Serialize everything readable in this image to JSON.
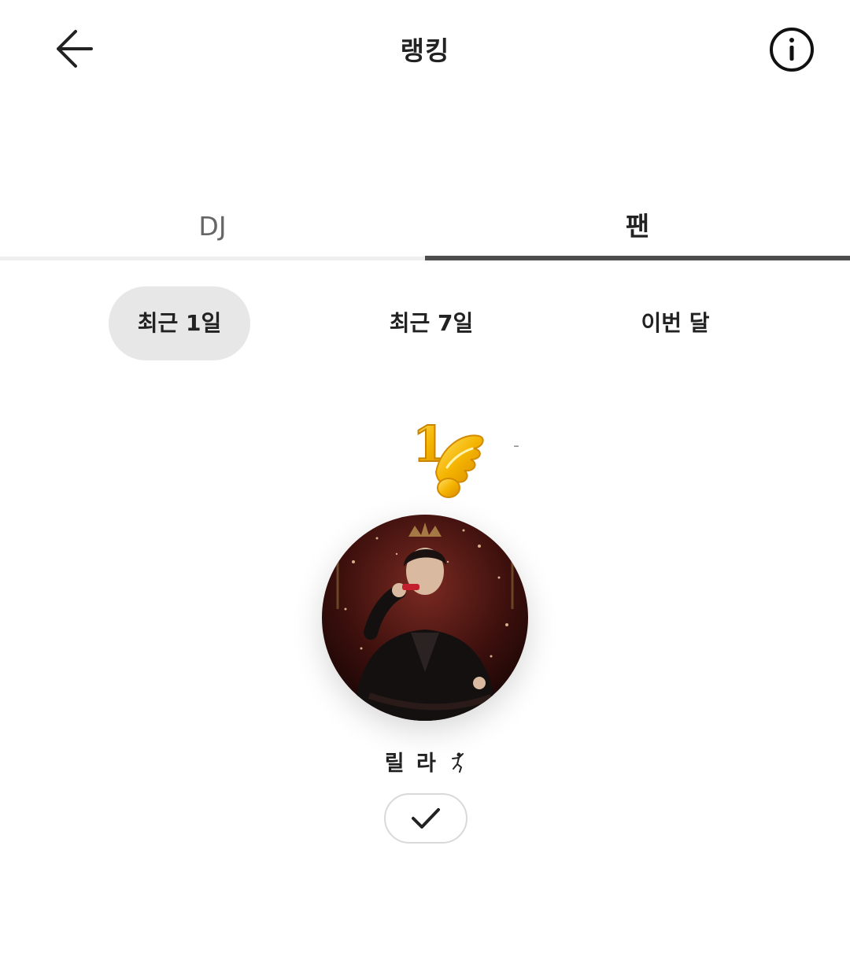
{
  "header": {
    "title": "랭킹",
    "back_icon": "arrow-left-icon",
    "info_icon": "info-icon"
  },
  "main_tabs": [
    {
      "label": "DJ",
      "active": false
    },
    {
      "label": "팬",
      "active": true
    }
  ],
  "period_tabs": [
    {
      "label": "최근 1일",
      "active": true
    },
    {
      "label": "최근 7일",
      "active": false
    },
    {
      "label": "이번 달",
      "active": false
    }
  ],
  "ranking": {
    "top": {
      "rank": "1",
      "rank_change": "-",
      "nickname": "릴 라",
      "nickname_icon": "dancer-icon",
      "action_icon": "check-icon"
    }
  },
  "colors": {
    "active_tab_underline": "#4d4d4d",
    "inactive_tab_underline": "#efefef",
    "selected_pill": "#e7e7e7",
    "badge_gold": "#f5b400"
  }
}
